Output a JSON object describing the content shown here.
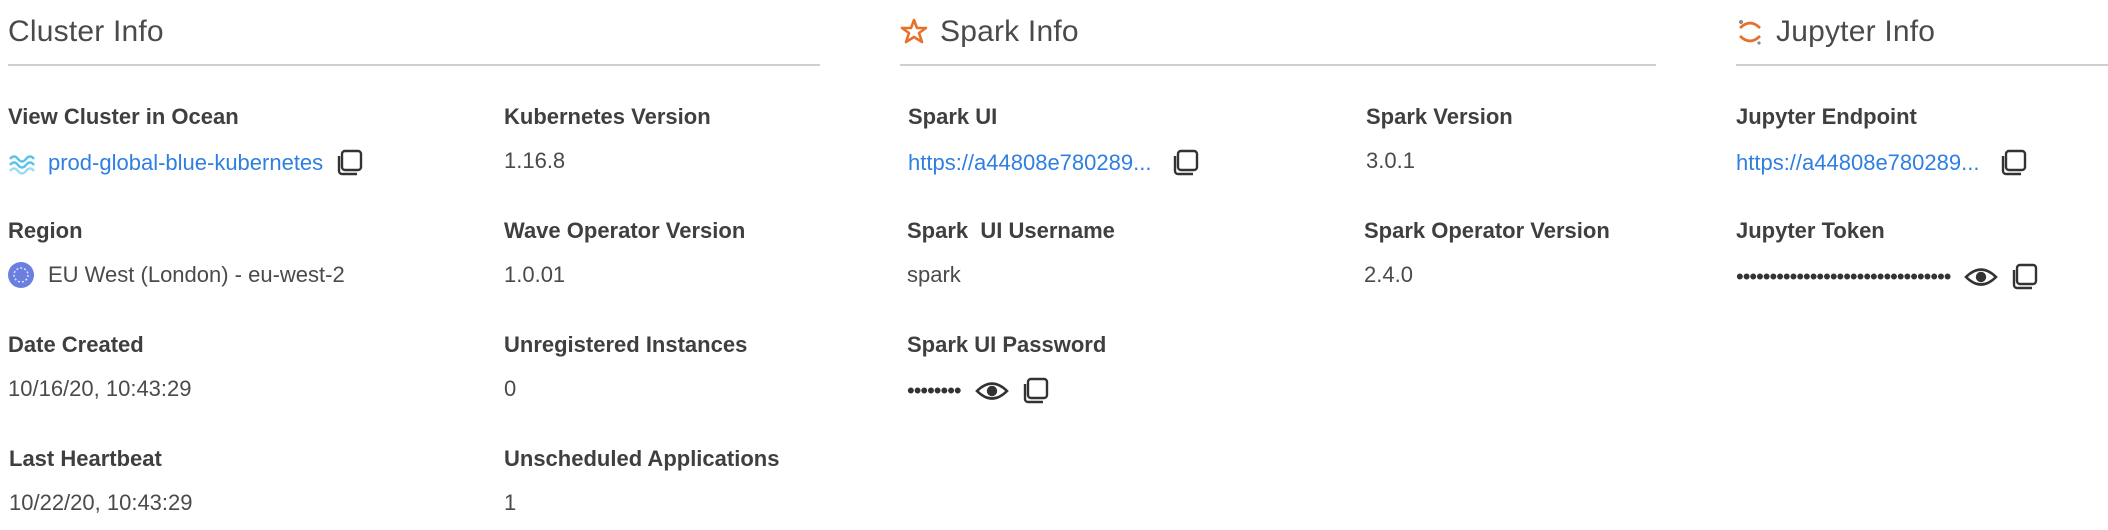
{
  "cluster": {
    "title": "Cluster Info",
    "fields": {
      "view_cluster": {
        "label": "View Cluster in Ocean",
        "value": "prod-global-blue-kubernetes"
      },
      "kubernetes_version": {
        "label": "Kubernetes Version",
        "value": "1.16.8"
      },
      "region": {
        "label": "Region",
        "value": "EU West (London) - eu-west-2"
      },
      "wave_operator_version": {
        "label": "Wave Operator Version",
        "value": "1.0.01"
      },
      "date_created": {
        "label": "Date Created",
        "value": "10/16/20, 10:43:29"
      },
      "unregistered_instances": {
        "label": "Unregistered Instances",
        "value": "0"
      },
      "last_heartbeat": {
        "label": "Last Heartbeat",
        "value": "10/22/20, 10:43:29"
      },
      "unscheduled_applications": {
        "label": "Unscheduled Applications",
        "value": "1"
      }
    }
  },
  "spark": {
    "title": "Spark Info",
    "fields": {
      "spark_ui": {
        "label": "Spark UI",
        "value": "https://a44808e780289..."
      },
      "spark_version": {
        "label": "Spark Version",
        "value": "3.0.1"
      },
      "spark_ui_username": {
        "label": "Spark  UI Username",
        "value": "spark"
      },
      "spark_operator_version": {
        "label": "Spark Operator Version",
        "value": "2.4.0"
      },
      "spark_ui_password": {
        "label": "Spark UI Password",
        "value": "••••••••"
      }
    }
  },
  "jupyter": {
    "title": "Jupyter Info",
    "fields": {
      "jupyter_endpoint": {
        "label": "Jupyter Endpoint",
        "value": "https://a44808e780289..."
      },
      "jupyter_token": {
        "label": "Jupyter Token",
        "value": "••••••••••••••••••••••••••••••••"
      }
    }
  },
  "icons": {
    "ocean": "ocean-icon",
    "region": "region-globe-icon",
    "spark": "spark-icon",
    "jupyter": "jupyter-icon",
    "copy": "copy-icon",
    "eye": "eye-icon"
  },
  "colors": {
    "link": "#2f7fe0",
    "spark_orange": "#e8702a",
    "region_blue": "#6a7fe0",
    "divider": "#cfcfcf"
  }
}
